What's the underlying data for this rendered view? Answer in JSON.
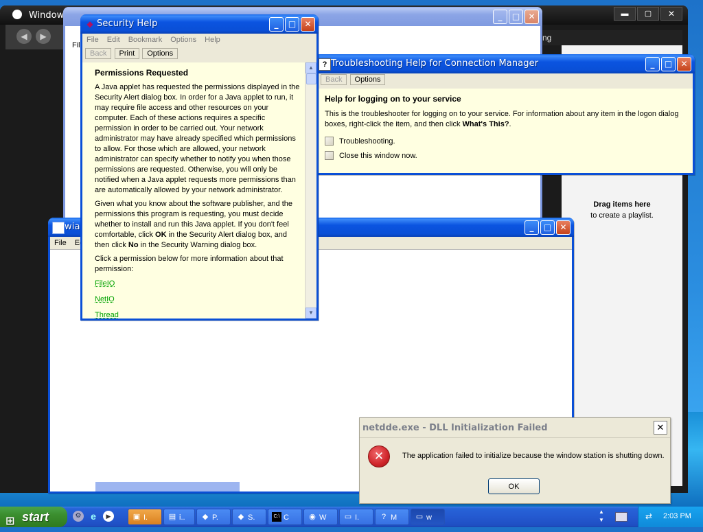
{
  "windows": {
    "media": {
      "title": "Windows Med"
    },
    "background_ie": {
      "menu_first": "File"
    },
    "playlist": {
      "drag_title": "Drag items here",
      "drag_sub": "to create a playlist.",
      "side_text": "ng"
    },
    "security_help": {
      "title": "Security Help",
      "menu": [
        "File",
        "Edit",
        "Bookmark",
        "Options",
        "Help"
      ],
      "toolbar": [
        "Back",
        "Print",
        "Options"
      ],
      "heading": "Permissions Requested",
      "para1": "A Java applet has requested the permissions displayed in the Security Alert dialog box. In order for a Java applet to run, it may require file access and other resources on your computer. Each of these actions requires a specific permission in order to be carried out. Your network administrator may have already specified which permissions to allow. For those which are allowed, your network administrator can specify whether to notify you when those permissions are requested. Otherwise, you will only be notified when a Java applet requests more permissions than are automatically allowed by your network administrator.",
      "para2_a": "Given what you know about the software publisher, and the permissions this program is requesting, you must decide whether to install and run this Java applet. If you don't feel comfortable, click ",
      "para2_ok": "OK",
      "para2_b": " in the Security Alert dialog box, and then click ",
      "para2_no": "No",
      "para2_c": " in the Security Warning dialog box.",
      "para3": "Click a permission below for more information about that permission:",
      "links": [
        "FileIO",
        "NetIO",
        "Thread"
      ]
    },
    "troubleshoot": {
      "title": "Troubleshooting Help for Connection Manager",
      "toolbar": [
        "Back",
        "Options"
      ],
      "heading": "Help for logging on to your service",
      "para_a": "This is the troubleshooter for logging on to your service. For information about any item in the logon dialog boxes, right-click the item, and then click ",
      "para_bold": "What's This?",
      "para_c": ".",
      "options": [
        "Troubleshooting.",
        "Close this window now."
      ]
    },
    "wia": {
      "title": "wia",
      "menu": [
        "File",
        "Ed"
      ]
    },
    "error": {
      "title": "netdde.exe - DLL Initialization Failed",
      "message": "The application failed to initialize because the window station is shutting down.",
      "ok": "OK"
    }
  },
  "taskbar": {
    "start": "start",
    "buttons": [
      "I.",
      "i..",
      "P.",
      "S.",
      "C",
      "W",
      "I.",
      "M",
      "w"
    ],
    "clock": "2:03 PM"
  },
  "colors": {
    "xp_blue": "#0a4fd6",
    "help_bg": "#ffffe1",
    "error_red": "#d0262b",
    "link_green": "#00a200"
  }
}
